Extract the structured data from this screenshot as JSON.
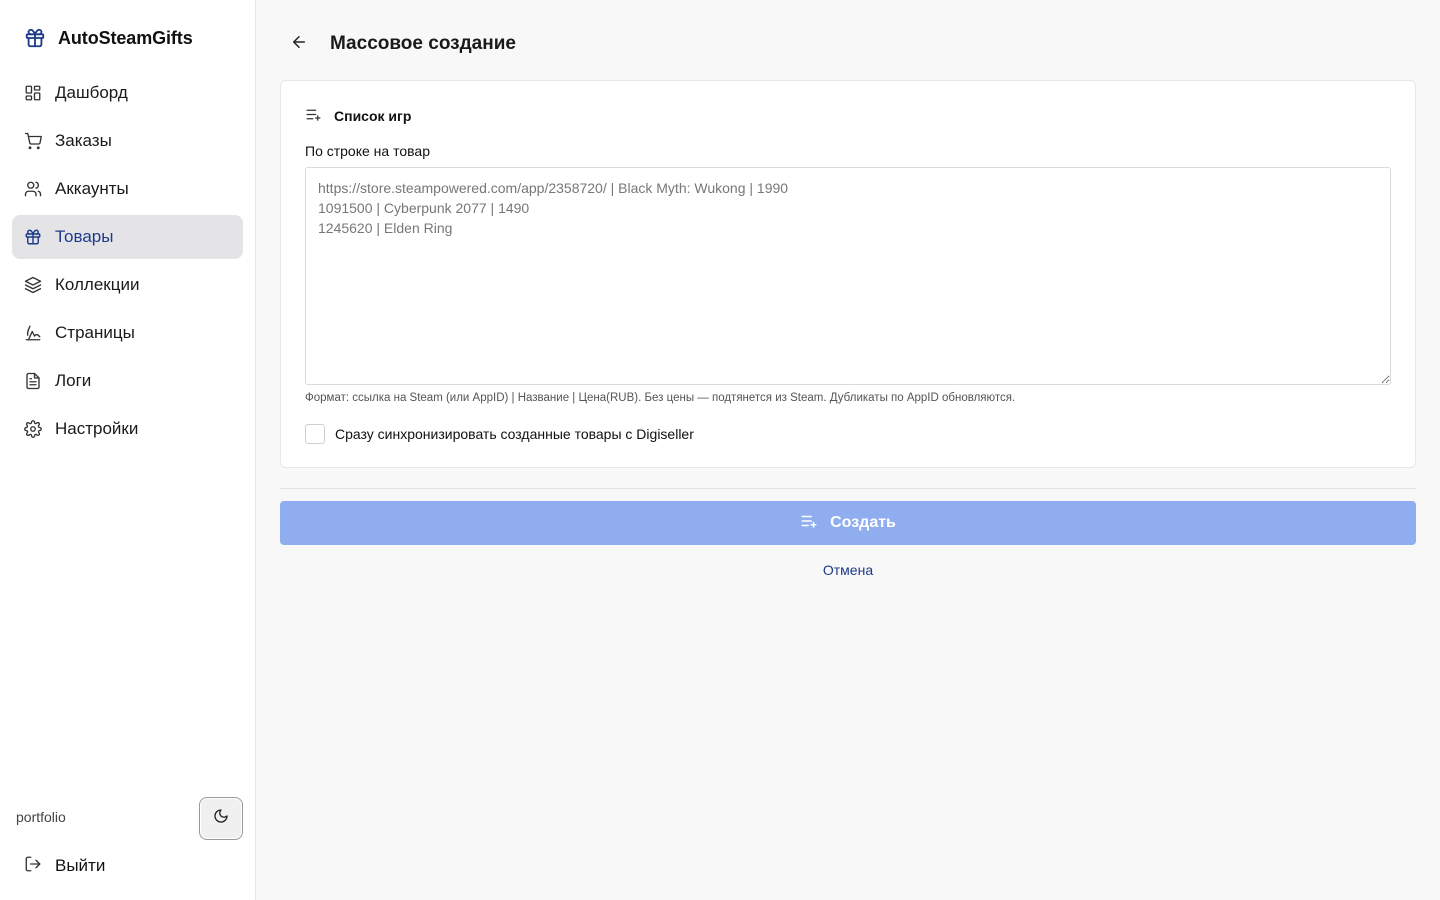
{
  "app": {
    "brand_name": "AutoSteamGifts",
    "brand_icon": "gift-icon"
  },
  "sidebar": {
    "items": [
      {
        "label": "Дашборд",
        "icon": "dashboard-icon"
      },
      {
        "label": "Заказы",
        "icon": "cart-icon"
      },
      {
        "label": "Аккаунты",
        "icon": "users-icon"
      },
      {
        "label": "Товары",
        "icon": "gift-icon",
        "active": true
      },
      {
        "label": "Коллекции",
        "icon": "layers-icon"
      },
      {
        "label": "Страницы",
        "icon": "signature-icon"
      },
      {
        "label": "Логи",
        "icon": "file-text-icon"
      },
      {
        "label": "Настройки",
        "icon": "gear-icon"
      }
    ],
    "footer_label": "portfolio",
    "theme_toggle_icon": "moon-icon",
    "logout_label": "Выйти",
    "logout_icon": "logout-icon"
  },
  "header": {
    "title": "Массовое создание",
    "back_icon": "arrow-left-icon"
  },
  "form": {
    "section_title": "Список игр",
    "section_icon": "list-plus-icon",
    "field_label": "По строке на товар",
    "textarea_placeholder": "https://store.steampowered.com/app/2358720/ | Black Myth: Wukong | 1990\n1091500 | Cyberpunk 2077 | 1490\n1245620 | Elden Ring",
    "hint": "Формат: ссылка на Steam (или AppID) | Название | Цена(RUB). Без цены — подтянется из Steam. Дубликаты по AppID обновляются.",
    "sync_checkbox_label": "Сразу синхронизировать созданные товары с Digiseller",
    "sync_checked": false
  },
  "actions": {
    "create_label": "Создать",
    "create_icon": "list-plus-icon",
    "cancel_label": "Отмена"
  },
  "colors": {
    "accent": "#1e3a8a",
    "button_bg": "#90aeef",
    "active_nav_bg": "#e4e4e7"
  }
}
